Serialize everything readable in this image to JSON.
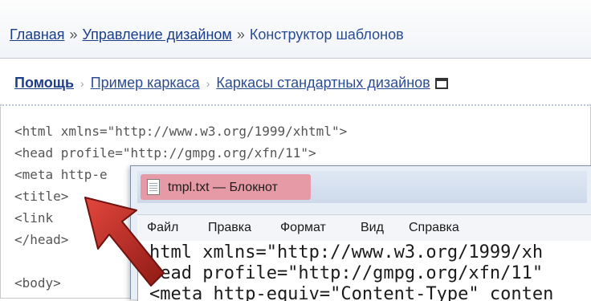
{
  "breadcrumb": {
    "home": "Главная",
    "sep1": "»",
    "design": "Управление дизайном",
    "sep2": "»",
    "current": "Конструктор шаблонов"
  },
  "help_bar": {
    "help": "Помощь",
    "arrow1": "›",
    "example": "Пример каркаса",
    "arrow2": "›",
    "standard": "Каркасы стандартных дизайнов"
  },
  "code_lines": [
    "<html xmlns=\"http://www.w3.org/1999/xhtml\">",
    "<head profile=\"http://gmpg.org/xfn/11\">",
    "<meta http-e",
    "<title>",
    "<link",
    "</head>",
    "",
    "<body>"
  ],
  "notepad": {
    "title": "tmpl.txt — Блокнот",
    "menu": [
      "Файл",
      "Правка",
      "Формат",
      "Вид",
      "Справка"
    ],
    "lines": [
      "html xmlns=\"http://www.w3.org/1999/xh",
      "head profile=\"http://gmpg.org/xfn/11\"",
      "<meta http-equiv=\"Content-Type\" conten"
    ]
  },
  "colors": {
    "link": "#1a3d8a",
    "title_highlight": "#e59aa5",
    "arrow": "#b3231c"
  },
  "icons": [
    "window-icon",
    "notepad-file-icon",
    "red-arrow"
  ]
}
